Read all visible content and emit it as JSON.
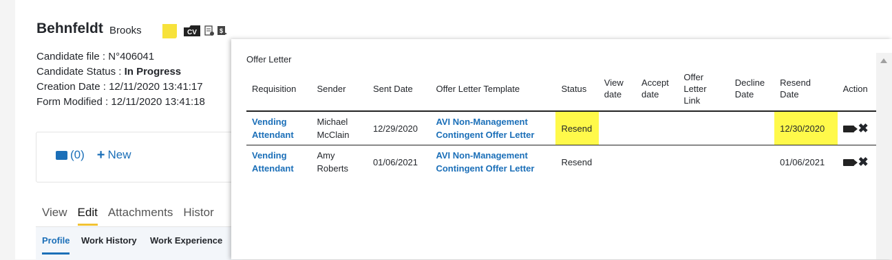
{
  "candidate": {
    "last_name": "Behnfeldt",
    "first_name": "Brooks",
    "file_label": "Candidate file : ",
    "file_value": "N°406041",
    "status_label": "Candidate Status : ",
    "status_value": "In Progress",
    "creation_label": "Creation Date : ",
    "creation_value": "12/11/2020 13:41:17",
    "modified_label": "Form Modified : ",
    "modified_value": "12/11/2020 13:41:18"
  },
  "icons": {
    "note": "note-icon",
    "cv": "cv-icon",
    "document": "document-settings-icon",
    "payment": "payment-icon",
    "cv_text": "CV"
  },
  "messages": {
    "count": "(0)",
    "new_label": "New"
  },
  "tabs": [
    {
      "label": "View"
    },
    {
      "label": "Edit"
    },
    {
      "label": "Attachments"
    },
    {
      "label": "Histor"
    }
  ],
  "subtabs": [
    {
      "label": "Profile"
    },
    {
      "label": "Work History"
    },
    {
      "label": "Work Experience"
    }
  ],
  "popup": {
    "title": "Offer Letter",
    "headers": [
      "Requisition",
      "Sender",
      "Sent Date",
      "Offer Letter Template",
      "Status",
      "View date",
      "Accept date",
      "Offer Letter Link",
      "Decline Date",
      "Resend Date",
      "Action"
    ],
    "header_lines": {
      "view_date": [
        "View",
        "date"
      ],
      "accept_date": [
        "Accept",
        "date"
      ],
      "offer_letter_link": [
        "Offer",
        "Letter",
        "Link"
      ],
      "decline_date": [
        "Decline",
        "Date"
      ],
      "resend_date": [
        "Resend",
        "Date"
      ]
    },
    "rows": [
      {
        "requisition": [
          "Vending",
          "Attendant"
        ],
        "sender": [
          "Michael",
          "McClain"
        ],
        "sent_date": "12/29/2020",
        "template": [
          "AVI Non-Management",
          "Contingent Offer Letter"
        ],
        "status": "Resend",
        "view_date": "",
        "accept_date": "",
        "offer_letter_link": "",
        "decline_date": "",
        "resend_date": "12/30/2020"
      },
      {
        "requisition": [
          "Vending",
          "Attendant"
        ],
        "sender": [
          "Amy",
          "Roberts"
        ],
        "sent_date": "01/06/2021",
        "template": [
          "AVI Non-Management",
          "Contingent Offer Letter"
        ],
        "status": "Resend",
        "view_date": "",
        "accept_date": "",
        "offer_letter_link": "",
        "decline_date": "",
        "resend_date": "01/06/2021"
      }
    ]
  },
  "colors": {
    "link": "#1b6fb8",
    "highlight": "#fff94a",
    "tab_underline": "#f1c232"
  }
}
